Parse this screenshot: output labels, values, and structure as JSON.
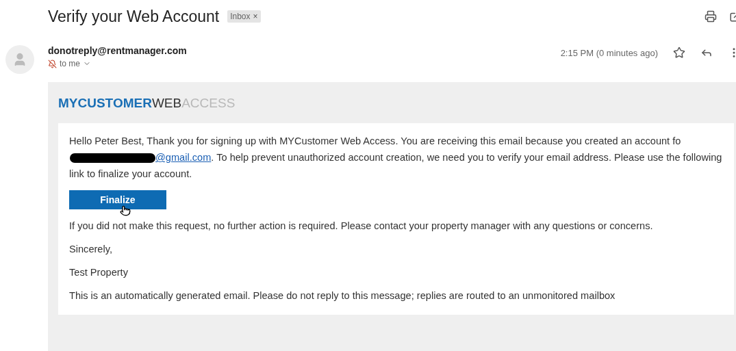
{
  "subject": "Verify your Web Account",
  "label": {
    "text": "Inbox",
    "close": "×"
  },
  "sender": {
    "address": "donotreply@rentmanager.com",
    "recipient": "to me",
    "time": "2:15 PM (0 minutes ago)",
    "starred": false
  },
  "email": {
    "logo": [
      {
        "text": "MYCUSTOMER",
        "color": "#1a6fb5",
        "bold": true
      },
      {
        "text": "WEB",
        "color": "#333333",
        "bold": false
      },
      {
        "text": "ACCESS",
        "color": "#b8b8b8",
        "bold": false
      }
    ],
    "intro": {
      "before": "Hello Peter Best, Thank you for signing up with MYCustomer Web Access. You are receiving this email because you created an account fo",
      "redacted": true,
      "link": "@gmail.com",
      "after": ". To help prevent unauthorized account creation, we need you to verify your email address. Please use the following link to finalize your account."
    },
    "button": "Finalize",
    "paragraphs": [
      "If you did not make this request, no further action is required. Please contact your property manager with any questions or concerns.",
      "Sincerely,",
      "Test Property",
      "This is an automatically generated email. Please do not reply to this message; replies are routed to an unmonitored mailbox"
    ]
  }
}
